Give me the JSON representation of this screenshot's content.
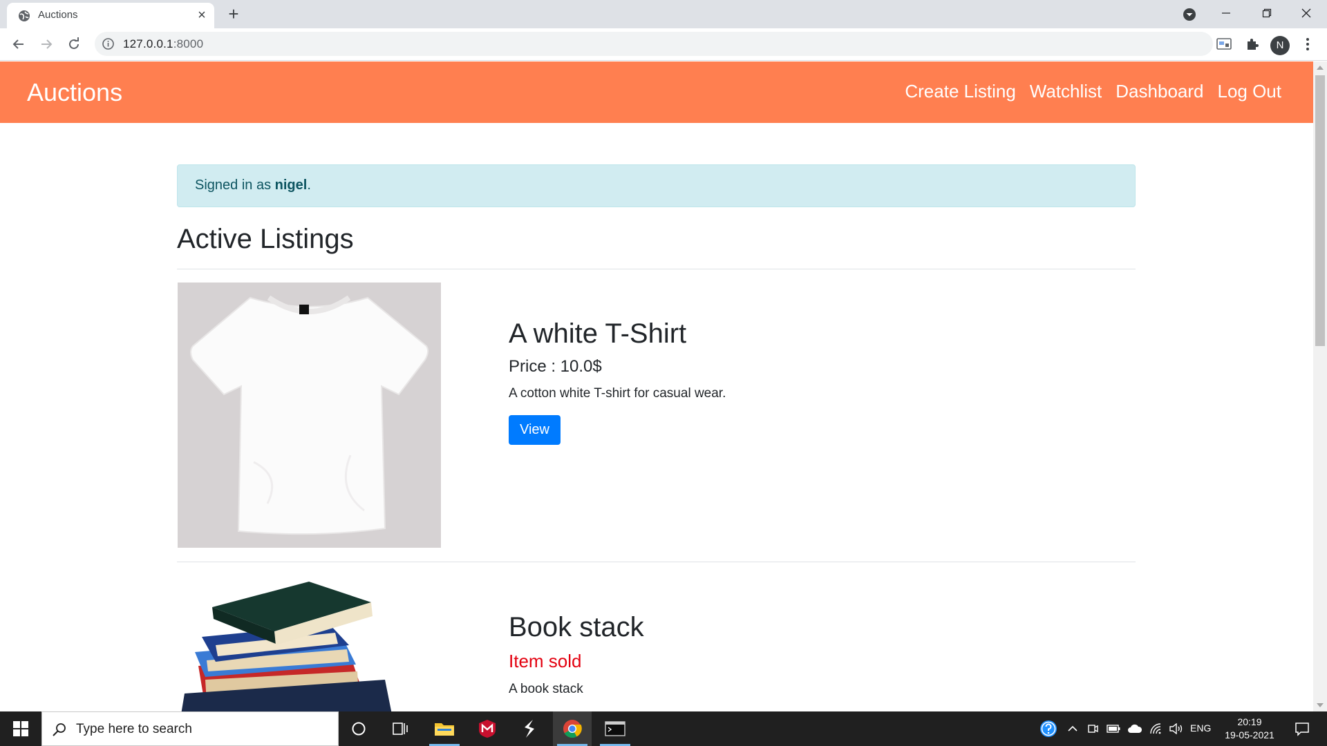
{
  "browser": {
    "tab_title": "Auctions",
    "tab_close": "×",
    "new_tab": "+",
    "url_host": "127.0.0.1",
    "url_port": ":8000",
    "profile_initial": "N"
  },
  "navbar": {
    "brand": "Auctions",
    "links": [
      "Create Listing",
      "Watchlist",
      "Dashboard",
      "Log Out"
    ]
  },
  "alert": {
    "prefix": "Signed in as ",
    "username": "nigel",
    "suffix": "."
  },
  "page": {
    "heading": "Active Listings"
  },
  "listings": [
    {
      "title": "A white T-Shirt",
      "price": "Price : 10.0$",
      "description": "A cotton white T-shirt for casual wear.",
      "button": "View"
    },
    {
      "title": "Book stack",
      "status": "Item sold",
      "description": "A book stack"
    }
  ],
  "taskbar": {
    "search_placeholder": "Type here to search",
    "language": "ENG",
    "time": "20:19",
    "date": "19-05-2021"
  },
  "colors": {
    "navbar": "#ff7f50",
    "alert_bg": "#d1ecf1",
    "alert_text": "#0c5460",
    "button": "#007bff",
    "sold": "#e3000f"
  },
  "icons": [
    "globe-icon",
    "close-icon",
    "plus-icon",
    "tab-search-icon",
    "minimize-icon",
    "maximize-icon",
    "window-close-icon",
    "back-arrow-icon",
    "forward-arrow-icon",
    "reload-icon",
    "info-icon",
    "star-icon",
    "media-router-icon",
    "puzzle-icon",
    "kebab-menu-icon",
    "windows-start-icon",
    "search-icon",
    "cortana-icon",
    "task-view-icon",
    "file-explorer-icon",
    "mcafee-icon",
    "sublime-icon",
    "chrome-icon",
    "terminal-icon",
    "help-icon",
    "chevron-up-icon",
    "meet-icon",
    "battery-icon",
    "cloud-icon",
    "wifi-icon",
    "volume-icon",
    "notifications-icon"
  ]
}
